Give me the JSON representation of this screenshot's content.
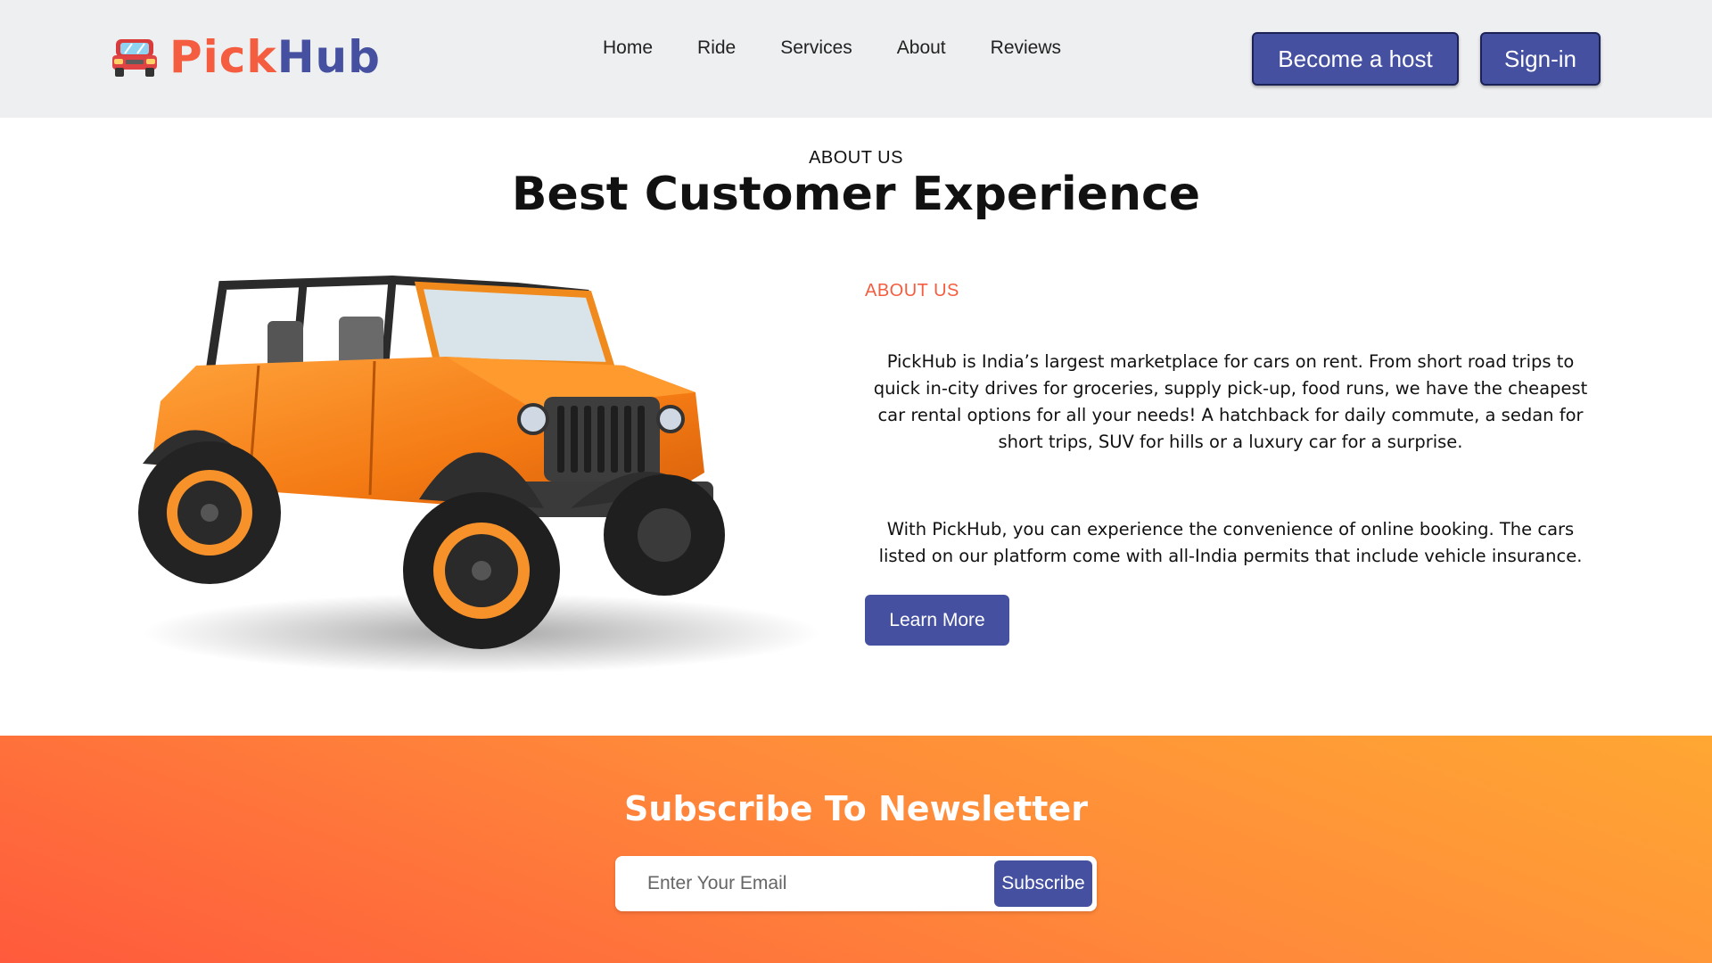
{
  "brand": {
    "name_part1": "Pick",
    "name_part2": "Hub",
    "logo_icon": "red-car-icon",
    "color_primary": "#f45d3f",
    "color_secondary": "#4551a0"
  },
  "nav": {
    "items": [
      {
        "label": "Home"
      },
      {
        "label": "Ride"
      },
      {
        "label": "Services"
      },
      {
        "label": "About"
      },
      {
        "label": "Reviews"
      }
    ]
  },
  "header_actions": {
    "host_label": "Become a host",
    "signin_label": "Sign-in"
  },
  "about": {
    "kicker": "ABOUT US",
    "heading": "Best Customer Experience",
    "label": "ABOUT US",
    "paragraph_1": "PickHub is India’s largest marketplace for cars on rent. From short road trips to quick in-city drives for groceries, supply pick-up, food runs, we have the cheapest car rental options for all your needs! A hatchback for daily commute, a sedan for short trips, SUV for hills or a luxury car for a surprise.",
    "paragraph_2": "With PickHub, you can experience the convenience of online booking. The cars listed on our platform come with all-India permits that include vehicle insurance.",
    "button_label": "Learn More",
    "image": "orange-jeep-image"
  },
  "newsletter": {
    "title": "Subscribe To Newsletter",
    "email_placeholder": "Enter Your Email",
    "email_value": "",
    "button_label": "Subscribe",
    "gradient_colors": [
      "#ff5a3c",
      "#ffa733"
    ]
  }
}
